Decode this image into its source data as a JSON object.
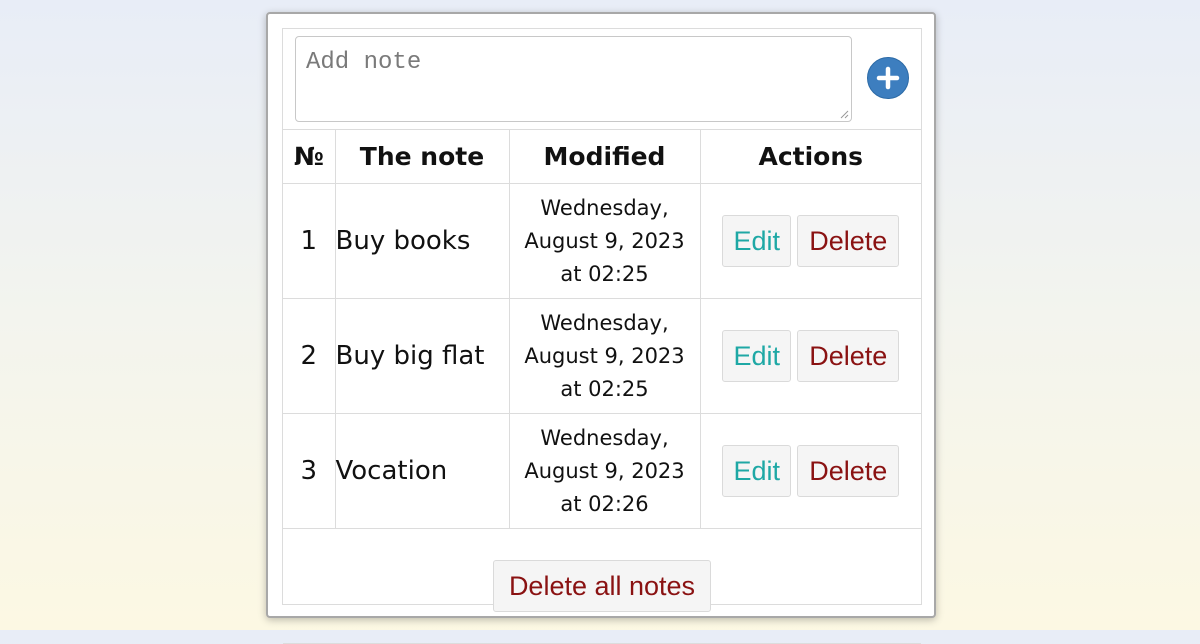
{
  "add_note": {
    "placeholder": "Add note",
    "add_button_icon": "plus-circle-icon"
  },
  "table": {
    "headers": {
      "number": "№",
      "note": "The note",
      "modified": "Modified",
      "actions": "Actions"
    },
    "rows": [
      {
        "number": "1",
        "note": "Buy books",
        "modified": [
          "Wednesday,",
          "August 9, 2023",
          "at 02:25"
        ],
        "edit_label": "Edit",
        "delete_label": "Delete"
      },
      {
        "number": "2",
        "note": "Buy big flat",
        "modified": [
          "Wednesday,",
          "August 9, 2023",
          "at 02:25"
        ],
        "edit_label": "Edit",
        "delete_label": "Delete"
      },
      {
        "number": "3",
        "note": "Vocation",
        "modified": [
          "Wednesday,",
          "August 9, 2023",
          "at 02:26"
        ],
        "edit_label": "Edit",
        "delete_label": "Delete"
      }
    ]
  },
  "footer": {
    "delete_all_label": "Delete all notes"
  },
  "colors": {
    "add_button": "#3d7ebf",
    "edit_text": "#1ea8a5",
    "delete_text": "#8a1212"
  }
}
